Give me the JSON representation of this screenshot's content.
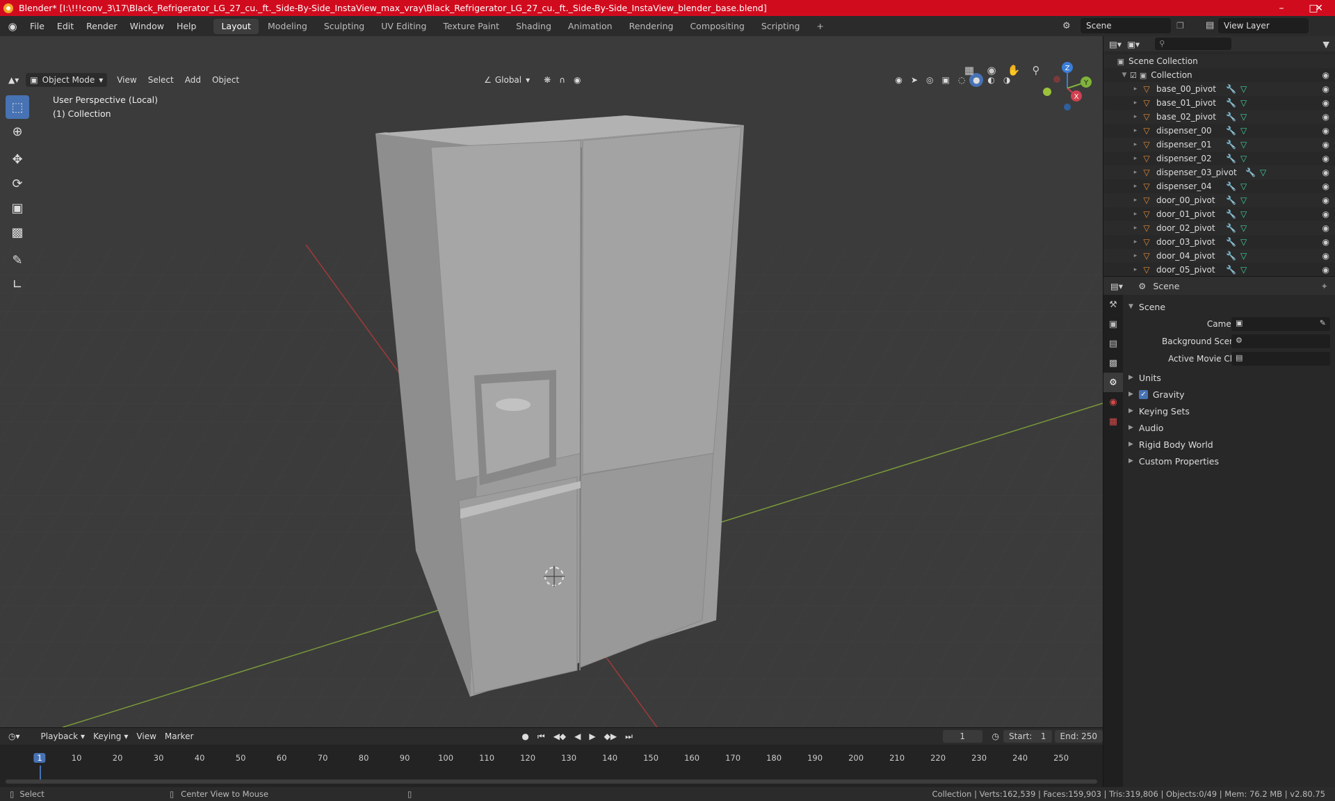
{
  "titlebar": {
    "title": "Blender* [I:\\!!!conv_3\\17\\Black_Refrigerator_LG_27_cu._ft._Side-By-Side_InstaView_max_vray\\Black_Refrigerator_LG_27_cu._ft._Side-By-Side_InstaView_blender_base.blend]",
    "bg": "#d10b1e"
  },
  "menu": {
    "items": [
      "File",
      "Edit",
      "Render",
      "Window",
      "Help"
    ],
    "workspaces": [
      "Layout",
      "Modeling",
      "Sculpting",
      "UV Editing",
      "Texture Paint",
      "Shading",
      "Animation",
      "Rendering",
      "Compositing",
      "Scripting"
    ],
    "active_workspace": "Layout",
    "add": "+",
    "scene": "Scene",
    "view_layer": "View Layer"
  },
  "viewport": {
    "mode": "Object Mode",
    "menus": [
      "View",
      "Select",
      "Add",
      "Object"
    ],
    "transform": "Global",
    "perspective": "User Perspective (Local)",
    "collection": "(1) Collection",
    "gizmo": {
      "z": "Z",
      "y": "Y",
      "x": "X"
    }
  },
  "outliner": {
    "root": "Scene Collection",
    "collection": "Collection",
    "objects": [
      "base_00_pivot",
      "base_01_pivot",
      "base_02_pivot",
      "dispenser_00",
      "dispenser_01",
      "dispenser_02",
      "dispenser_03_pivot",
      "dispenser_04",
      "door_00_pivot",
      "door_01_pivot",
      "door_02_pivot",
      "door_03_pivot",
      "door_04_pivot",
      "door_05_pivot"
    ]
  },
  "properties": {
    "title": "Scene",
    "panel": "Scene",
    "camera_label": "Camera",
    "bg_scene_label": "Background Scene",
    "movie_clip_label": "Active Movie Clip",
    "subpanels": [
      "Units",
      "Gravity",
      "Keying Sets",
      "Audio",
      "Rigid Body World",
      "Custom Properties"
    ],
    "gravity_checked": true
  },
  "timeline": {
    "menus": [
      "Playback",
      "Keying",
      "View",
      "Marker"
    ],
    "current_frame": "1",
    "start_label": "Start:",
    "start": "1",
    "end_label": "End:",
    "end": "250",
    "ruler": [
      "1",
      "10",
      "20",
      "30",
      "40",
      "50",
      "60",
      "70",
      "80",
      "90",
      "100",
      "110",
      "120",
      "130",
      "140",
      "150",
      "160",
      "170",
      "180",
      "190",
      "200",
      "210",
      "220",
      "230",
      "240",
      "250"
    ]
  },
  "status": {
    "select": "Select",
    "center": "Center View to Mouse",
    "stats": "Collection | Verts:162,539 | Faces:159,903 | Tris:319,806 | Objects:0/49 | Mem: 76.2 MB | v2.80.75"
  }
}
